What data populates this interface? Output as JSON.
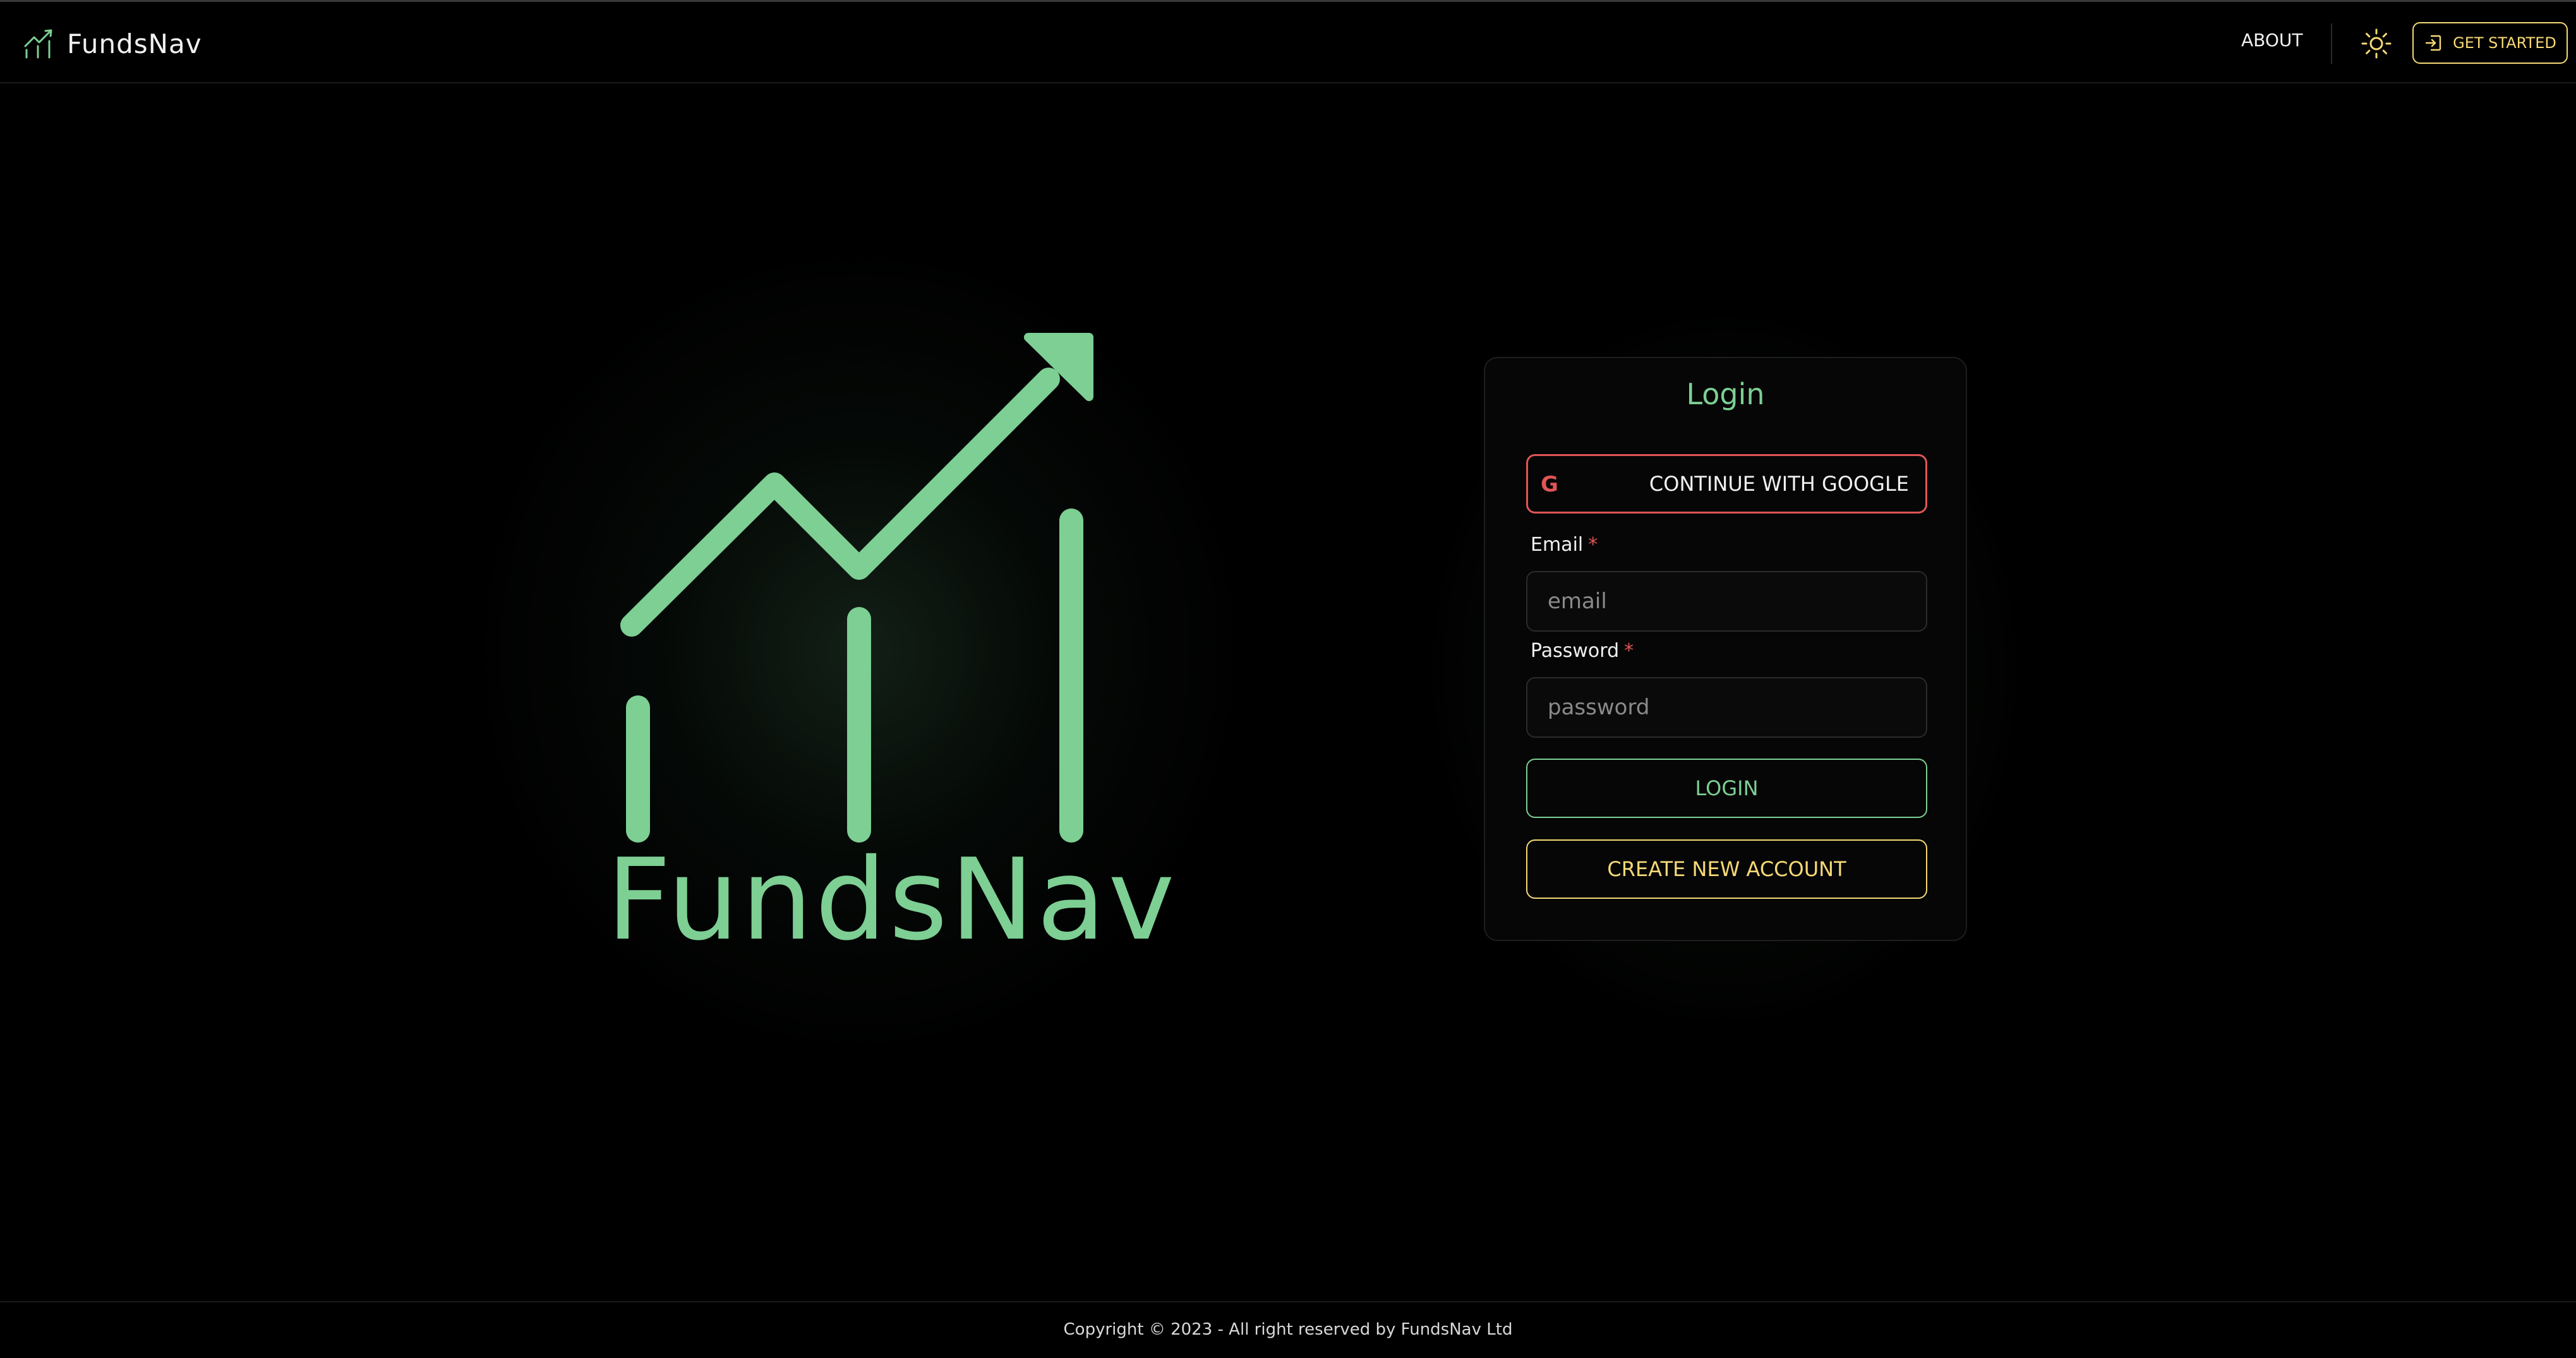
{
  "header": {
    "brand": "FundsNav",
    "brand_icon": "chart-growth-icon",
    "nav_about": "ABOUT",
    "theme_icon": "sun-icon",
    "get_started": "GET STARTED",
    "get_started_icon": "login-icon"
  },
  "hero": {
    "logo_icon": "fundsnav-logo-icon",
    "logo_text": "FundsNav"
  },
  "login": {
    "title": "Login",
    "google_button": "CONTINUE WITH GOOGLE",
    "google_icon": "G",
    "email_label": "Email",
    "email_placeholder": "email",
    "email_value": "",
    "password_label": "Password",
    "password_placeholder": "password",
    "password_value": "",
    "required_marker": "*",
    "login_button": "LOGIN",
    "create_button": "CREATE NEW ACCOUNT"
  },
  "footer": {
    "copyright": "Copyright © 2023 - All right reserved by FundsNav Ltd"
  },
  "colors": {
    "accent_green": "#7dcf93",
    "accent_yellow": "#f6d976",
    "accent_red": "#e05555",
    "background": "#000000"
  }
}
